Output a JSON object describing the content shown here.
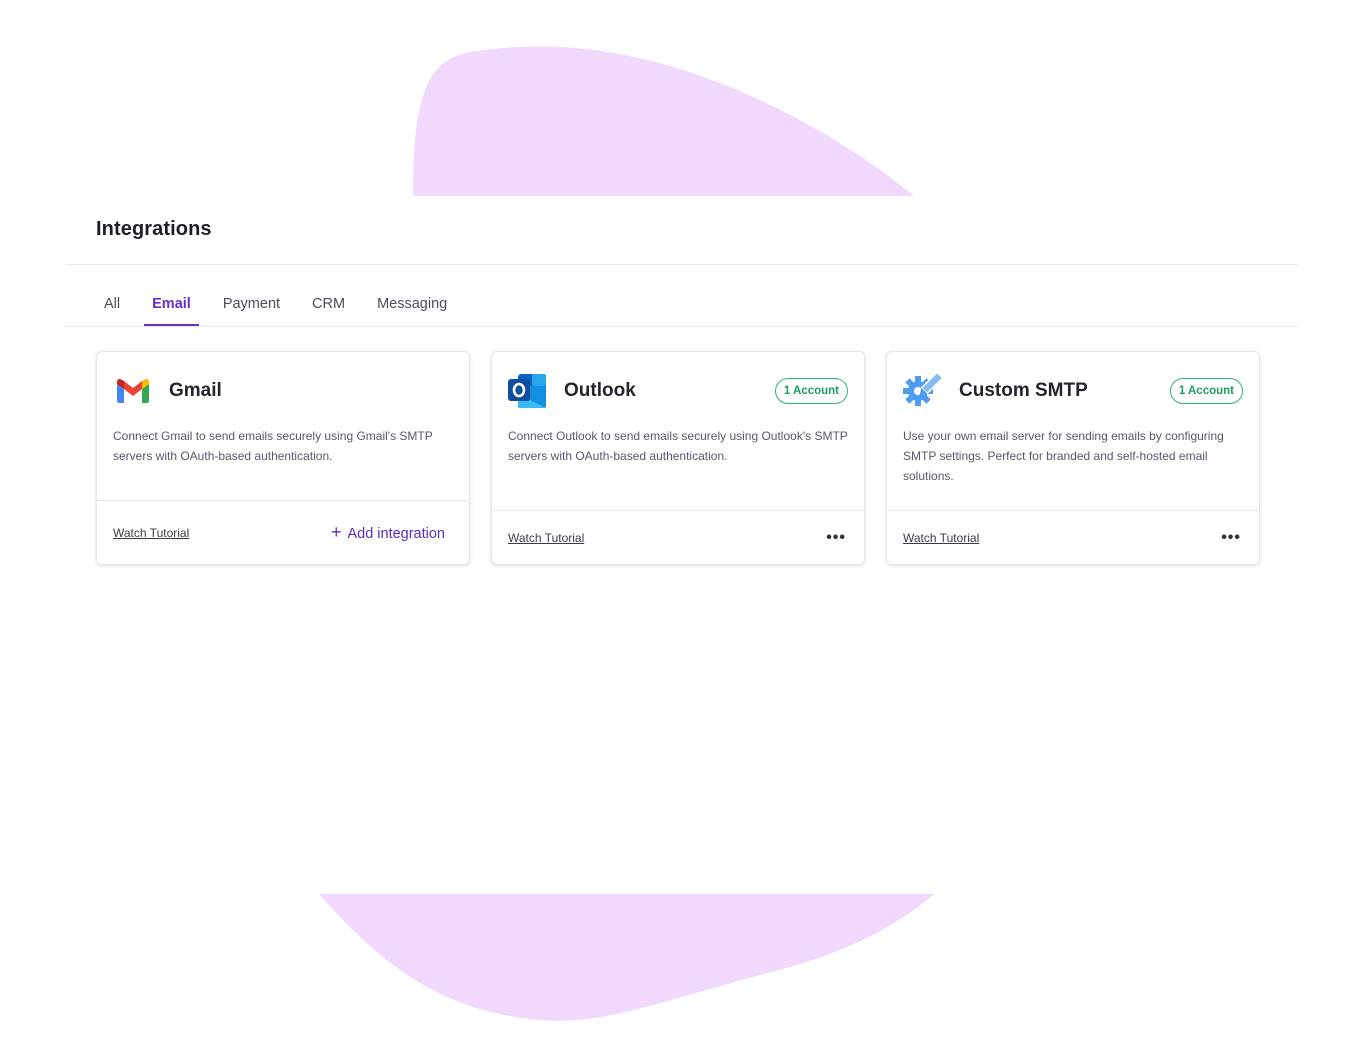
{
  "page": {
    "title": "Integrations"
  },
  "tabs": [
    {
      "label": "All",
      "active": false
    },
    {
      "label": "Email",
      "active": true
    },
    {
      "label": "Payment",
      "active": false
    },
    {
      "label": "CRM",
      "active": false
    },
    {
      "label": "Messaging",
      "active": false
    }
  ],
  "cards": [
    {
      "name": "Gmail",
      "icon": "gmail-icon",
      "description": "Connect Gmail to send emails securely using Gmail's SMTP servers with OAuth-based authentication.",
      "tutorial_label": "Watch Tutorial",
      "action_label": "Add integration",
      "action_icon": "plus-icon"
    },
    {
      "name": "Outlook",
      "icon": "outlook-icon",
      "badge": "1 Account",
      "description": "Connect Outlook to send emails securely using Outlook's SMTP servers with OAuth-based authentication.",
      "tutorial_label": "Watch Tutorial",
      "more_icon": "more-icon"
    },
    {
      "name": "Custom SMTP",
      "icon": "smtp-gear-icon",
      "badge": "1 Account",
      "description": "Use your own email server for sending emails by configuring SMTP settings. Perfect for branded and self-hosted email solutions.",
      "tutorial_label": "Watch Tutorial",
      "more_icon": "more-icon"
    }
  ],
  "colors": {
    "accent": "#6a2fc9",
    "badge": "#2eb872",
    "blob": "#f0d9fd"
  }
}
